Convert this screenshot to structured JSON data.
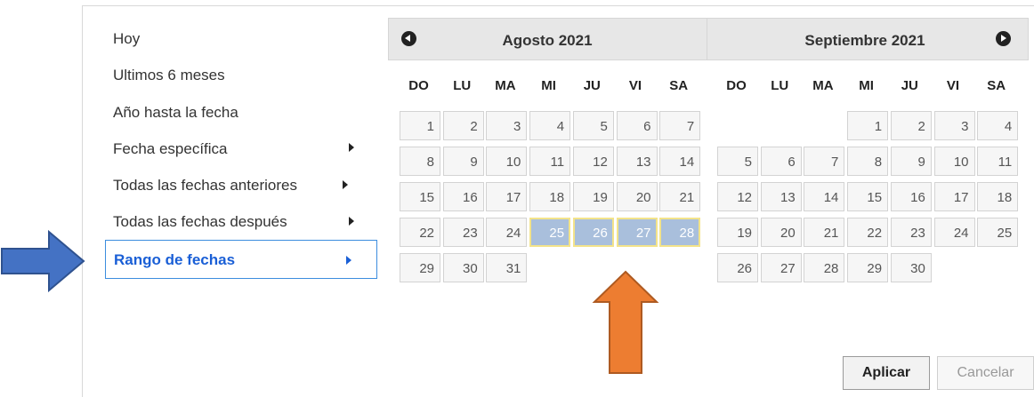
{
  "menu": {
    "items": [
      {
        "label": "Hoy",
        "has_submenu": false
      },
      {
        "label": "Ultimos 6 meses",
        "has_submenu": false
      },
      {
        "label": "Año hasta la fecha",
        "has_submenu": false
      },
      {
        "label": "Fecha específica",
        "has_submenu": true
      },
      {
        "label": "Todas las fechas anteriores",
        "has_submenu": true
      },
      {
        "label": "Todas las fechas después",
        "has_submenu": true
      }
    ],
    "selected": {
      "label": "Rango de fechas",
      "has_submenu": true
    }
  },
  "calendar": {
    "weekdays": [
      "DO",
      "LU",
      "MA",
      "MI",
      "JU",
      "VI",
      "SA"
    ],
    "months": [
      {
        "title": "Agosto 2021",
        "first_weekday": 0,
        "days_in_month": 31,
        "selected_days": [
          25,
          26,
          27,
          28
        ]
      },
      {
        "title": "Septiembre 2021",
        "first_weekday": 3,
        "days_in_month": 30,
        "selected_days": []
      }
    ]
  },
  "buttons": {
    "apply": "Aplicar",
    "cancel": "Cancelar"
  },
  "annotations": {
    "left_arrow_color": "#4472c4",
    "up_arrow_color": "#ed7d31"
  },
  "colors": {
    "selected_day_fill": "#a9bfdc",
    "selected_day_border": "#f3e38a",
    "selected_menu_text": "#1a5fd6"
  }
}
